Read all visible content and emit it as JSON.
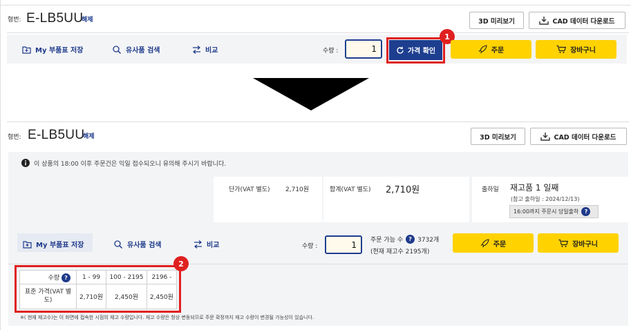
{
  "top": {
    "model_label": "형번:",
    "model_value": "E-LB5UU",
    "clear_label": "해제",
    "btn_3d": "3D 미리보기",
    "btn_cad": "CAD 데이터 다운로드",
    "tools": {
      "save": "My 부품표 저장",
      "similar": "유사품 검색",
      "compare": "비교"
    },
    "qty_label": "수량 :",
    "qty_value": "1",
    "price_check": "가격 확인",
    "order": "주문",
    "cart": "장바구니",
    "badge": "1"
  },
  "bottom": {
    "model_label": "형번:",
    "model_value": "E-LB5UU",
    "clear_label": "해제",
    "btn_3d": "3D 미리보기",
    "btn_cad": "CAD 데이터 다운로드",
    "notice": "이 상품의 18:00 이후 주문건은 익일 접수되오니 유의해 주시기 바랍니다.",
    "unit_price_label": "단가(VAT 별도)",
    "unit_price_value": "2,710원",
    "total_label": "합계(VAT 별도)",
    "total_value": "2,710원",
    "ship_label": "출하일",
    "ship_value": "재고품 1 일째",
    "ship_ref": "(참고 출하일 : 2024/12/13)",
    "ship_badge": "16:00까지 주문시 당일출하",
    "tools": {
      "save": "My 부품표 저장",
      "similar": "유사품 검색",
      "compare": "비교"
    },
    "qty_label": "수량 :",
    "qty_value": "1",
    "orderable_label": "주문 가능 수",
    "orderable_value": "3732개",
    "stock_note": "(현재 재고수 2195개)",
    "order": "주문",
    "cart": "장바구니",
    "badge": "2",
    "table": {
      "row1": [
        "수량",
        "1 - 99",
        "100 - 2195",
        "2196 -"
      ],
      "row2": [
        "표준 가격(VAT 별도)",
        "2,710원",
        "2,450원",
        "2,450원"
      ]
    },
    "footnote": "※( 현재 재고수)는 이 화면에 접속한 시점의 재고 수량입니다. 재고 수량은 항상 변동되므로 주문 확정까지 재고 수량이 변경될 가능성이 있습니다."
  }
}
